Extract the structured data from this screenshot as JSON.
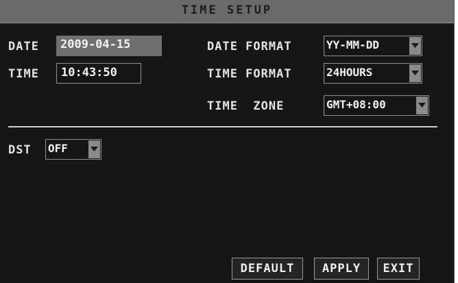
{
  "window": {
    "title": "TIME SETUP"
  },
  "date": {
    "label": "DATE",
    "value": "2009-04-15"
  },
  "time": {
    "label": "TIME",
    "value": "10:43:50"
  },
  "date_format": {
    "label": "DATE FORMAT",
    "value": "YY-MM-DD",
    "icon": "chevron-down-icon"
  },
  "time_format": {
    "label": "TIME FORMAT",
    "value": "24HOURS",
    "icon": "chevron-down-icon"
  },
  "time_zone": {
    "label": "TIME  ZONE",
    "value": "GMT+08:00",
    "icon": "chevron-down-icon"
  },
  "dst": {
    "label": "DST",
    "value": "OFF",
    "icon": "chevron-down-icon"
  },
  "buttons": {
    "default": "DEFAULT",
    "apply": "APPLY",
    "exit": "EXIT"
  },
  "colors": {
    "panel": "#161616",
    "titlebar": "#6a6a6a",
    "text": "#f2f2f2"
  }
}
